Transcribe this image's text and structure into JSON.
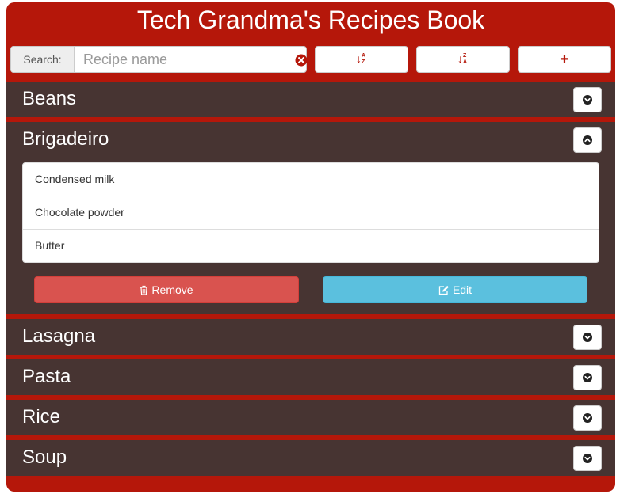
{
  "app": {
    "title": "Tech Grandma's Recipes Book",
    "colors": {
      "brand": "#b5170a",
      "panel": "#473432",
      "remove": "#d9534f",
      "edit": "#5bc0de"
    }
  },
  "toolbar": {
    "search_label": "Search:",
    "search_placeholder": "Recipe name",
    "search_value": "",
    "clear_icon": "times-circle-icon",
    "sort_asc_icon": "sort-alpha-asc-icon",
    "sort_asc_arrow": "↓",
    "sort_asc_top": "A",
    "sort_asc_bottom": "Z",
    "sort_desc_icon": "sort-alpha-desc-icon",
    "sort_desc_arrow": "↓",
    "sort_desc_top": "Z",
    "sort_desc_bottom": "A",
    "add_icon": "plus-icon",
    "add_glyph": "+"
  },
  "recipes": [
    {
      "name": "Beans",
      "expanded": false,
      "toggle_icon": "chevron-down-icon"
    },
    {
      "name": "Brigadeiro",
      "expanded": true,
      "toggle_icon": "chevron-up-icon",
      "ingredients": [
        "Condensed milk",
        "Chocolate powder",
        "Butter"
      ],
      "remove_label": "Remove",
      "remove_icon": "trash-icon",
      "edit_label": "Edit",
      "edit_icon": "edit-icon"
    },
    {
      "name": "Lasagna",
      "expanded": false,
      "toggle_icon": "chevron-down-icon"
    },
    {
      "name": "Pasta",
      "expanded": false,
      "toggle_icon": "chevron-down-icon"
    },
    {
      "name": "Rice",
      "expanded": false,
      "toggle_icon": "chevron-down-icon"
    },
    {
      "name": "Soup",
      "expanded": false,
      "toggle_icon": "chevron-down-icon"
    }
  ]
}
